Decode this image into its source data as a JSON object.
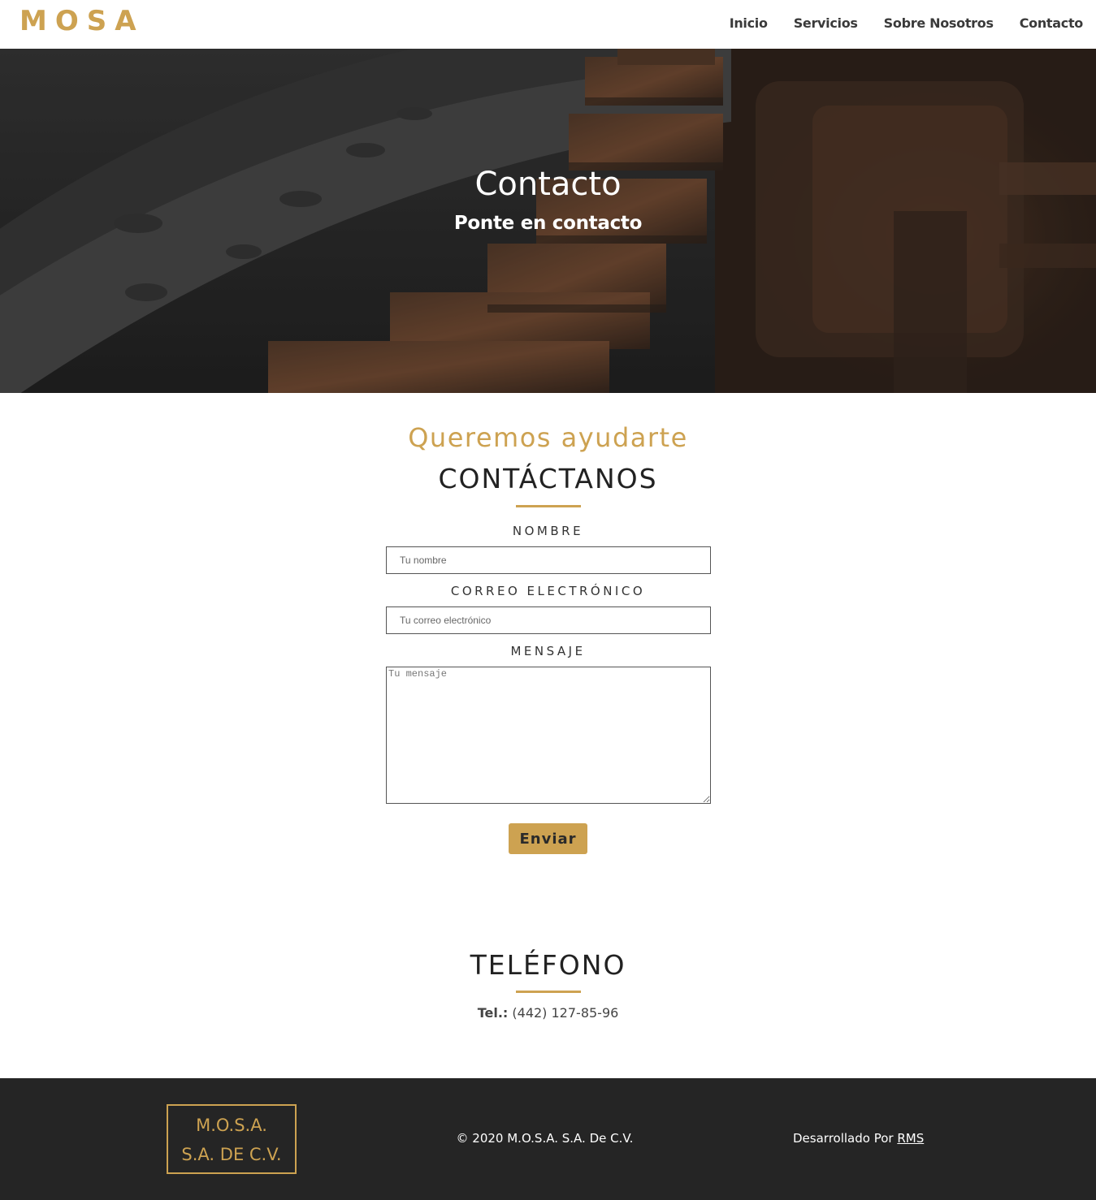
{
  "header": {
    "logo": "MOSA",
    "nav": [
      "Inicio",
      "Servicios",
      "Sobre Nosotros",
      "Contacto"
    ]
  },
  "hero": {
    "title": "Contacto",
    "subtitle": "Ponte en contacto"
  },
  "contact": {
    "kicker": "Queremos ayudarte",
    "title": "CONTÁCTANOS",
    "name_label": "NOMBRE",
    "name_placeholder": "Tu nombre",
    "email_label": "CORREO ELECTRÓNICO",
    "email_placeholder": "Tu correo electrónico",
    "message_label": "MENSAJE",
    "message_placeholder": "Tu mensaje",
    "submit_label": "Enviar"
  },
  "phone": {
    "title": "TELÉFONO",
    "prefix": "Tel.:",
    "number": "(442) 127-85-96"
  },
  "footer": {
    "brand_line1": "M.O.S.A.",
    "brand_line2": "S.A. DE C.V.",
    "copyright": "© 2020 M.O.S.A. S.A. De C.V.",
    "dev_text": "Desarrollado Por",
    "dev_link": "RMS"
  },
  "colors": {
    "accent": "#cda251",
    "footer_bg": "#252525",
    "text_dark": "#222222"
  }
}
